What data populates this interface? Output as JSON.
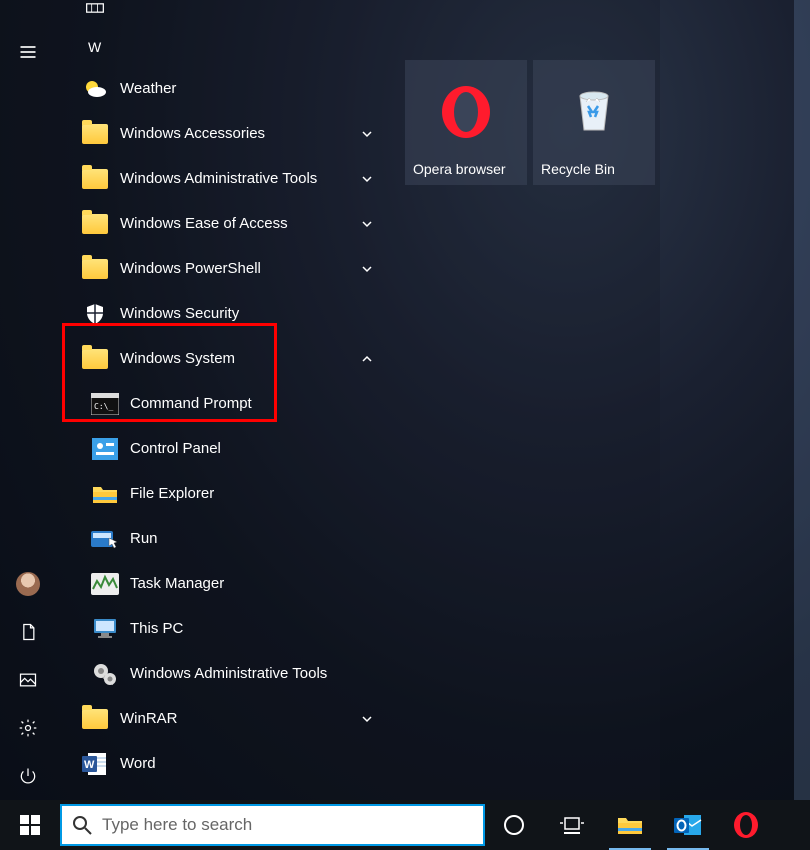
{
  "letterHeader": "W",
  "apps": {
    "weather": "Weather",
    "accessories": "Windows Accessories",
    "adminTools": "Windows Administrative Tools",
    "easeAccess": "Windows Ease of Access",
    "powershell": "Windows PowerShell",
    "security": "Windows Security",
    "system": "Windows System",
    "cmd": "Command Prompt",
    "controlPanel": "Control Panel",
    "fileExplorer": "File Explorer",
    "run": "Run",
    "taskManager": "Task Manager",
    "thisPC": "This PC",
    "adminTools2": "Windows Administrative Tools",
    "winrar": "WinRAR",
    "word": "Word"
  },
  "tiles": {
    "opera": "Opera browser",
    "recycle": "Recycle Bin"
  },
  "search": {
    "placeholder": "Type here to search"
  }
}
